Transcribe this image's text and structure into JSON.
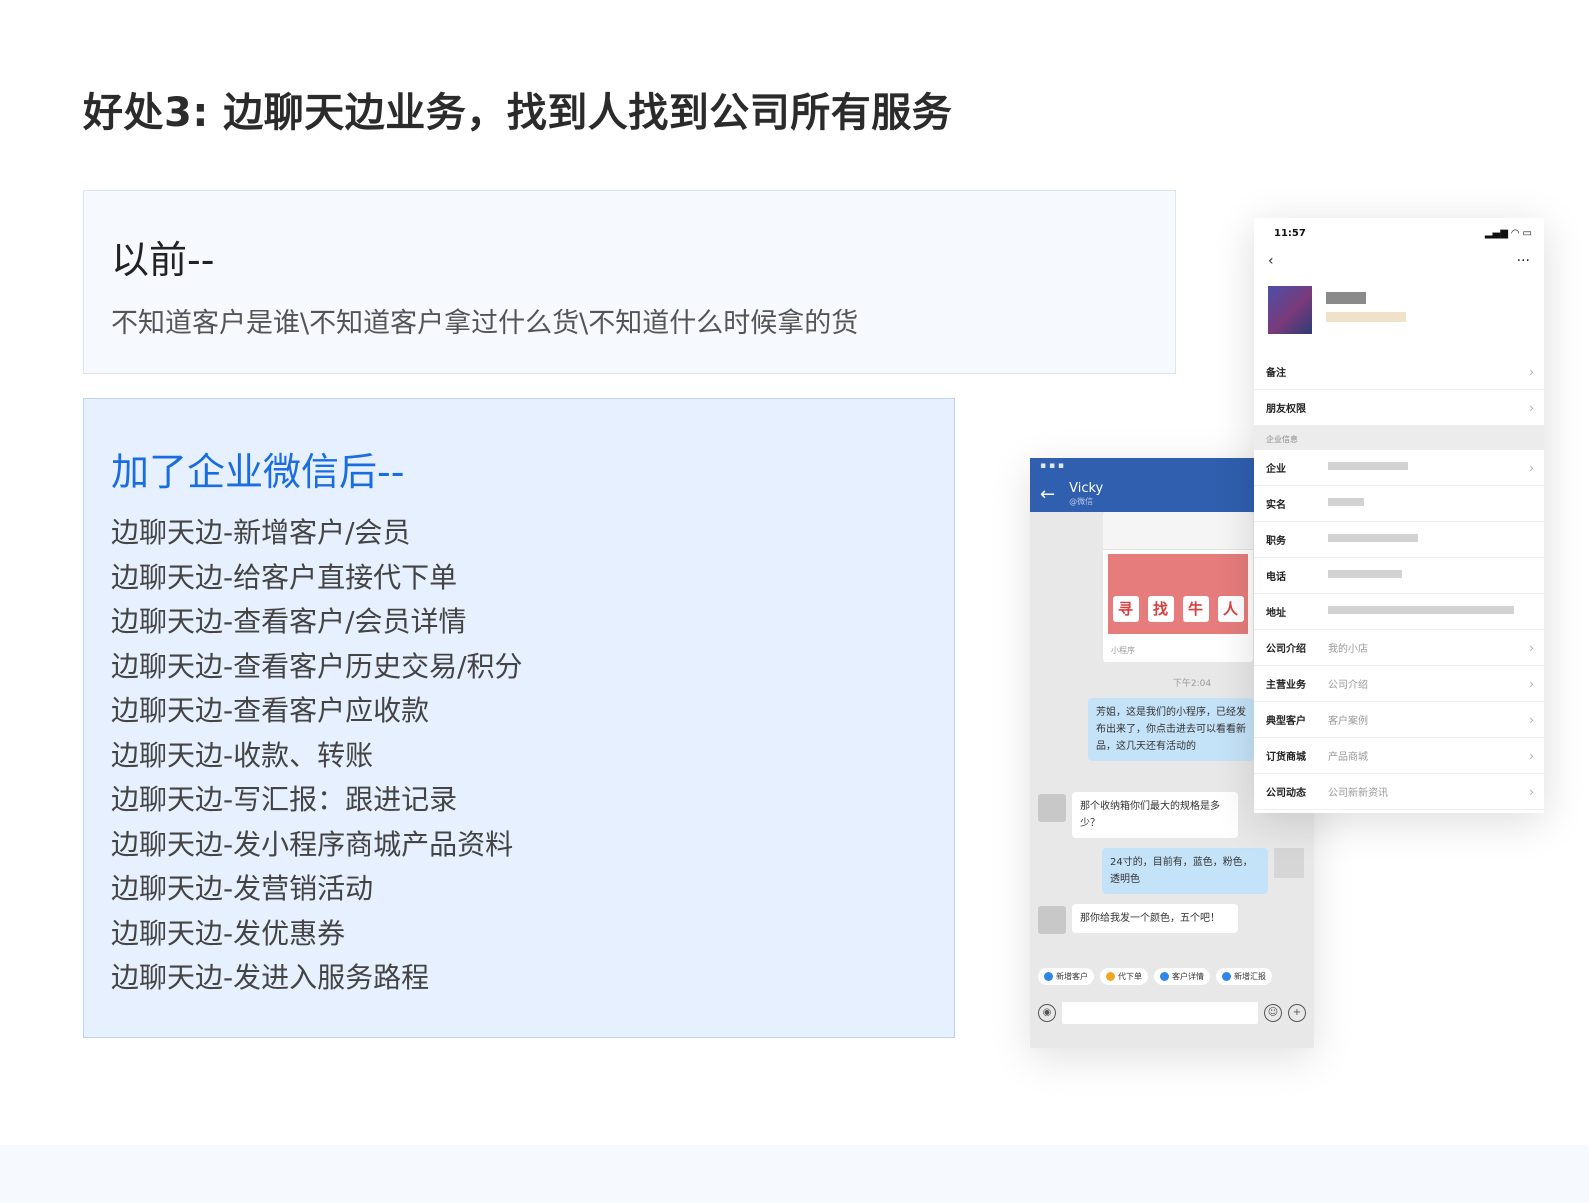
{
  "page": {
    "title": "好处3: 边聊天边业务，找到人找到公司所有服务"
  },
  "before": {
    "heading": "以前--",
    "text": "不知道客户是谁\\不知道客户拿过什么货\\不知道什么时候拿的货"
  },
  "after": {
    "heading": "加了企业微信后--",
    "items": [
      "边聊天边-新增客户/会员",
      "边聊天边-给客户直接代下单",
      "边聊天边-查看客户/会员详情",
      "边聊天边-查看客户历史交易/积分",
      "边聊天边-查看客户应收款",
      "边聊天边-收款、转账",
      "边聊天边-写汇报：跟进记录",
      "边聊天边-发小程序商城产品资料",
      "边聊天边-发营销活动",
      "边聊天边-发优惠券",
      "边聊天边-发进入服务路程"
    ]
  },
  "chat_phone": {
    "contact_name": "Vicky",
    "contact_sub": "@微信",
    "banner_chars": [
      "寻",
      "找",
      "牛",
      "人"
    ],
    "mini_tag": "小程序",
    "time": "下午2:04",
    "messages": [
      {
        "side": "right",
        "text": "芳姐，这是我们的小程序，已经发布出来了，你点击进去可以看看新品，这几天还有活动的"
      },
      {
        "side": "left",
        "text": "那个收纳箱你们最大的规格是多少？"
      },
      {
        "side": "right",
        "text": "24寸的，目前有，蓝色，粉色，透明色"
      },
      {
        "side": "left",
        "text": "那你给我发一个颜色，五个吧！"
      }
    ],
    "quick_actions": [
      {
        "label": "新增客户",
        "color": "#2f86e8"
      },
      {
        "label": "代下单",
        "color": "#f0a623"
      },
      {
        "label": "客户详情",
        "color": "#2f86e8"
      },
      {
        "label": "新增汇报",
        "color": "#2f86e8"
      }
    ]
  },
  "profile_phone": {
    "time": "11:57",
    "rows_top": [
      {
        "label": "备注"
      },
      {
        "label": "朋友权限"
      }
    ],
    "section_label": "企业信息",
    "rows_info": [
      {
        "label": "企业",
        "value": "",
        "chevron": true
      },
      {
        "label": "实名",
        "value": "",
        "chevron": false
      },
      {
        "label": "职务",
        "value": "",
        "chevron": false
      },
      {
        "label": "电话",
        "value": "",
        "chevron": false
      },
      {
        "label": "地址",
        "value": "",
        "chevron": false
      },
      {
        "label": "公司介绍",
        "value": "我的小店",
        "chevron": true
      },
      {
        "label": "主营业务",
        "value": "公司介绍",
        "chevron": true
      },
      {
        "label": "典型客户",
        "value": "客户案例",
        "chevron": true
      },
      {
        "label": "订货商城",
        "value": "产品商城",
        "chevron": true
      },
      {
        "label": "公司动态",
        "value": "公司新新资讯",
        "chevron": true
      }
    ]
  }
}
